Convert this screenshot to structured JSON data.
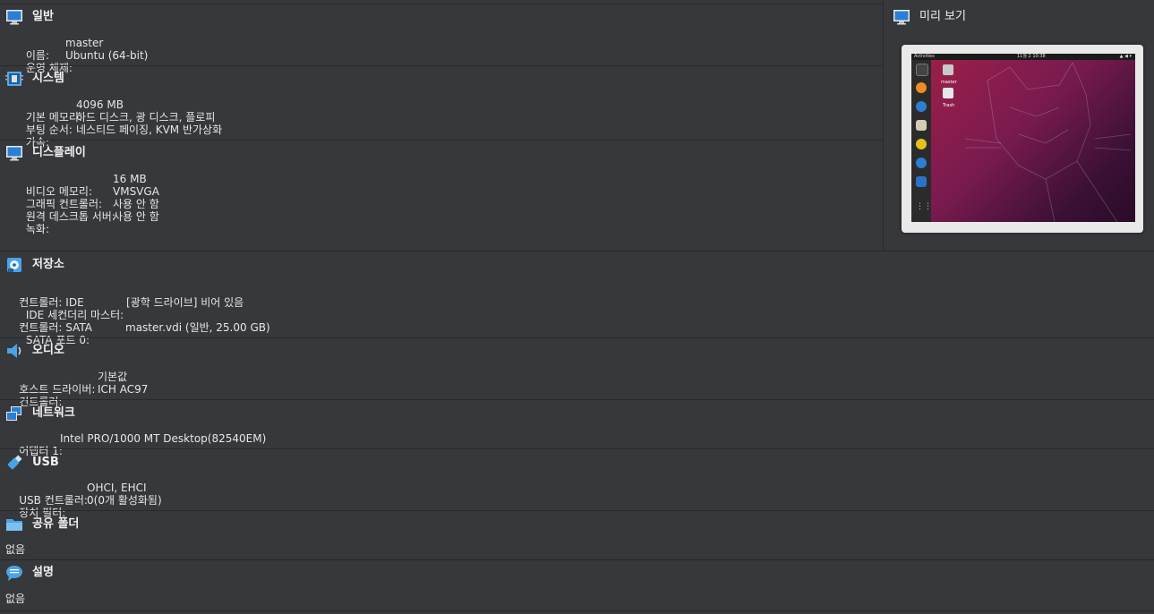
{
  "general": {
    "title": "일반",
    "rows": [
      {
        "key": "이름:",
        "value": "master"
      },
      {
        "key": "운영 체제:",
        "value": "Ubuntu (64-bit)"
      }
    ]
  },
  "system": {
    "title": "시스템",
    "rows": [
      {
        "key": "기본 메모리:",
        "value": "4096 MB"
      },
      {
        "key": "부팅 순서:",
        "value": "하드 디스크, 광 디스크, 플로피"
      },
      {
        "key": "가속:",
        "value": "네스티드 페이징, KVM 반가상화"
      }
    ]
  },
  "display": {
    "title": "디스플레이",
    "rows": [
      {
        "key": "비디오 메모리:",
        "value": "16 MB"
      },
      {
        "key": "그래픽 컨트롤러:",
        "value": "VMSVGA"
      },
      {
        "key": "원격 데스크톱 서버:",
        "value": "사용 안 함"
      },
      {
        "key": "녹화:",
        "value": "사용 안 함"
      }
    ]
  },
  "preview": {
    "title": "미리 보기",
    "topbar_activities": "Activities",
    "topbar_clock": "11월 2 10:38",
    "desktop_home_label": "master",
    "desktop_trash_label": "Trash"
  },
  "storage": {
    "title": "저장소",
    "lines": [
      {
        "key": "컨트롤러: IDE",
        "value": ""
      },
      {
        "key": "  IDE 세컨더리 마스터:",
        "value": "[광학 드라이브] 비어 있음"
      },
      {
        "key": "컨트롤러: SATA",
        "value": ""
      },
      {
        "key": "  SATA 포트 0:",
        "value": "master.vdi (일반, 25.00 GB)"
      }
    ]
  },
  "audio": {
    "title": "오디오",
    "rows": [
      {
        "key": "호스트 드라이버:",
        "value": "기본값"
      },
      {
        "key": "컨트롤러:",
        "value": "ICH AC97"
      }
    ]
  },
  "network": {
    "title": "네트워크",
    "rows": [
      {
        "key": "어댑터 1:",
        "value": "Intel PRO/1000 MT Desktop(82540EM)"
      }
    ]
  },
  "usb": {
    "title": "USB",
    "rows": [
      {
        "key": "USB 컨트롤러:",
        "value": "OHCI, EHCI"
      },
      {
        "key": "장치 필터:",
        "value": "0(0개 활성화됨)"
      }
    ]
  },
  "shared": {
    "title": "공유 폴더",
    "text": "없음"
  },
  "description": {
    "title": "설명",
    "text": "없음"
  },
  "icons": {
    "general": "monitor-icon",
    "system": "chip-icon",
    "display": "monitor-icon",
    "preview": "monitor-icon",
    "storage": "disk-icon",
    "audio": "speaker-icon",
    "network": "network-icon",
    "usb": "usb-icon",
    "shared": "folder-icon",
    "description": "speech-bubble-icon"
  }
}
